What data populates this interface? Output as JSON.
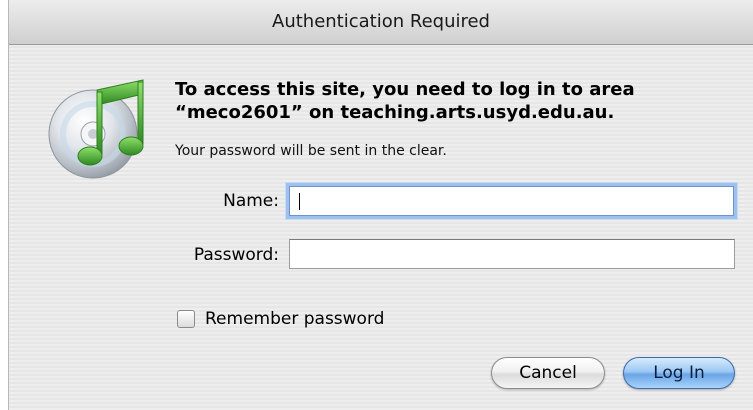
{
  "window": {
    "title": "Authentication Required"
  },
  "icon": {
    "name": "itunes-icon",
    "colors": {
      "disc": "#d9dde2",
      "note": "#5dbb3f",
      "note_dark": "#2f7f22"
    }
  },
  "message": {
    "line1": "To access this site, you need to log in to area",
    "line2": "“meco2601” on teaching.arts.usyd.edu.au.",
    "subtext": "Your password will be sent in the clear."
  },
  "form": {
    "name_label": "Name:",
    "name_value": "",
    "password_label": "Password:",
    "password_value": "",
    "remember_label": "Remember password",
    "remember_checked": false
  },
  "buttons": {
    "cancel_label": "Cancel",
    "login_label": "Log In"
  },
  "colors": {
    "default_button": "#6aa5e6",
    "focus_ring": "#9fc1ee"
  }
}
